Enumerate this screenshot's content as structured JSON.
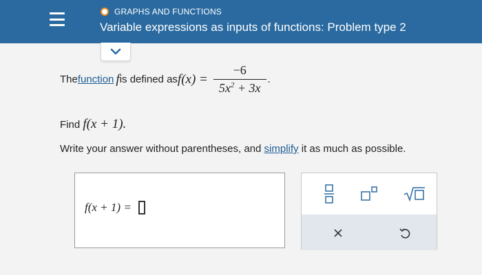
{
  "header": {
    "breadcrumb": "GRAPHS AND FUNCTIONS",
    "title": "Variable expressions as inputs of functions: Problem type 2"
  },
  "question": {
    "intro_prefix": "The ",
    "intro_link": "function",
    "intro_var": "f",
    "intro_suffix": " is defined as ",
    "fx": "f(x) =",
    "numerator": "−6",
    "den_a": "5x",
    "den_exp": "2",
    "den_b": " + 3x",
    "end_period": ".",
    "find_prefix": "Find ",
    "find_expr": "f(x + 1).",
    "instruction_prefix": "Write your answer without parentheses, and ",
    "instruction_link": "simplify",
    "instruction_suffix": " it as much as possible."
  },
  "answer": {
    "label": "f(x + 1) ="
  },
  "palette": {
    "fraction_icon": "fraction-icon",
    "exponent_icon": "exponent-icon",
    "sqrt_icon": "sqrt-icon",
    "clear_icon": "clear-icon",
    "undo_icon": "undo-icon"
  },
  "colors": {
    "header_bg": "#2a6aa0",
    "link": "#1c5d95",
    "status_dot": "#f08a1c"
  }
}
